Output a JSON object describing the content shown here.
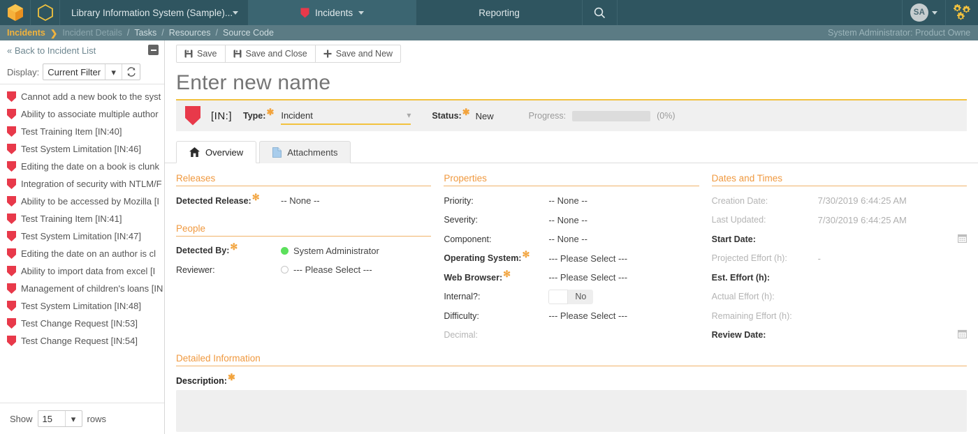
{
  "topnav": {
    "logo_primary": "hexagon-cube-logo",
    "logo_secondary": "hexagon-outline-logo",
    "project_name": "Library Information System (Sample)...",
    "incidents_tab": "Incidents",
    "reporting_tab": "Reporting",
    "search_icon": "search-icon",
    "avatar_initials": "SA",
    "settings_icon": "gears-icon"
  },
  "breadcrumb": {
    "items": [
      {
        "label": "Incidents",
        "state": "active"
      },
      {
        "label": "Incident Details",
        "state": "dim"
      },
      {
        "label": "Tasks",
        "state": "normal"
      },
      {
        "label": "Resources",
        "state": "normal"
      },
      {
        "label": "Source Code",
        "state": "normal"
      }
    ],
    "user_role": "System Administrator: Product Owne"
  },
  "sidebar": {
    "back_label": "« Back to Incident List",
    "display_label": "Display:",
    "filter_value": "Current Filter",
    "items": [
      {
        "label": "Cannot add a new book to the syst"
      },
      {
        "label": "Ability to associate multiple author"
      },
      {
        "label": "Test Training Item [IN:40]"
      },
      {
        "label": "Test System Limitation [IN:46]"
      },
      {
        "label": "Editing the date on a book is clunk"
      },
      {
        "label": "Integration of security with NTLM/F"
      },
      {
        "label": "Ability to be accessed by Mozilla [I"
      },
      {
        "label": "Test Training Item [IN:41]"
      },
      {
        "label": "Test System Limitation [IN:47]"
      },
      {
        "label": "Editing the date on an author is cl"
      },
      {
        "label": "Ability to import data from excel [I"
      },
      {
        "label": "Management of children's loans [IN"
      },
      {
        "label": "Test System Limitation [IN:48]"
      },
      {
        "label": "Test Change Request [IN:53]"
      },
      {
        "label": "Test Change Request [IN:54]"
      }
    ],
    "show_label": "Show",
    "rows_value": "15",
    "rows_label": "rows"
  },
  "toolbar": {
    "save_label": "Save",
    "save_close_label": "Save and Close",
    "save_new_label": "Save and New"
  },
  "record": {
    "name_placeholder": "Enter new name",
    "id_code": "[IN:]",
    "type_label": "Type:",
    "type_value": "Incident",
    "status_label": "Status:",
    "status_value": "New",
    "progress_label": "Progress:",
    "progress_percent": "(0%)",
    "progress_value": 0
  },
  "tabs": [
    {
      "label": "Overview",
      "icon": "home-icon",
      "active": true
    },
    {
      "label": "Attachments",
      "icon": "document-icon",
      "active": false
    }
  ],
  "sections": {
    "releases": {
      "title": "Releases",
      "fields": [
        {
          "label": "Detected Release:",
          "required": true,
          "bold": true,
          "value": "-- None --"
        }
      ]
    },
    "people": {
      "title": "People",
      "fields": [
        {
          "label": "Detected By:",
          "required": true,
          "bold": true,
          "value": "System Administrator",
          "marker": "green-dot"
        },
        {
          "label": "Reviewer:",
          "required": false,
          "bold": false,
          "value": "--- Please Select ---",
          "marker": "empty-circle"
        }
      ]
    },
    "properties": {
      "title": "Properties",
      "fields": [
        {
          "label": "Priority:",
          "required": false,
          "bold": false,
          "value": "-- None --"
        },
        {
          "label": "Severity:",
          "required": false,
          "bold": false,
          "value": "-- None --"
        },
        {
          "label": "Component:",
          "required": false,
          "bold": false,
          "value": "-- None --"
        },
        {
          "label": "Operating System:",
          "required": true,
          "bold": true,
          "value": "--- Please Select ---"
        },
        {
          "label": "Web Browser:",
          "required": true,
          "bold": true,
          "value": "--- Please Select ---"
        },
        {
          "label": "Internal?:",
          "required": false,
          "bold": false,
          "value": "No",
          "control": "toggle"
        },
        {
          "label": "Difficulty:",
          "required": false,
          "bold": false,
          "value": "--- Please Select ---"
        },
        {
          "label": "Decimal:",
          "required": false,
          "bold": false,
          "disabled": true,
          "value": ""
        }
      ]
    },
    "dates": {
      "title": "Dates and Times",
      "fields": [
        {
          "label": "Creation Date:",
          "disabled": true,
          "bold": false,
          "value": "7/30/2019 6:44:25 AM"
        },
        {
          "label": "Last Updated:",
          "disabled": true,
          "bold": false,
          "value": "7/30/2019 6:44:25 AM"
        },
        {
          "label": "Start Date:",
          "disabled": false,
          "bold": true,
          "value": "",
          "calendar": true
        },
        {
          "label": "Projected Effort (h):",
          "disabled": true,
          "bold": false,
          "value": "-"
        },
        {
          "label": "Est. Effort (h):",
          "disabled": false,
          "bold": true,
          "value": ""
        },
        {
          "label": "Actual Effort (h):",
          "disabled": true,
          "bold": false,
          "value": ""
        },
        {
          "label": "Remaining Effort (h):",
          "disabled": true,
          "bold": false,
          "value": ""
        },
        {
          "label": "Review Date:",
          "disabled": false,
          "bold": true,
          "value": "",
          "calendar": true
        }
      ]
    },
    "detailed": {
      "title": "Detailed Information",
      "description_label": "Description:"
    }
  },
  "colors": {
    "nav_bg": "#2f5560",
    "breadcrumb_bg": "#5b7b84",
    "accent_orange": "#f0993f",
    "accent_yellow": "#f2c23e",
    "shield_red": "#e8394a"
  }
}
